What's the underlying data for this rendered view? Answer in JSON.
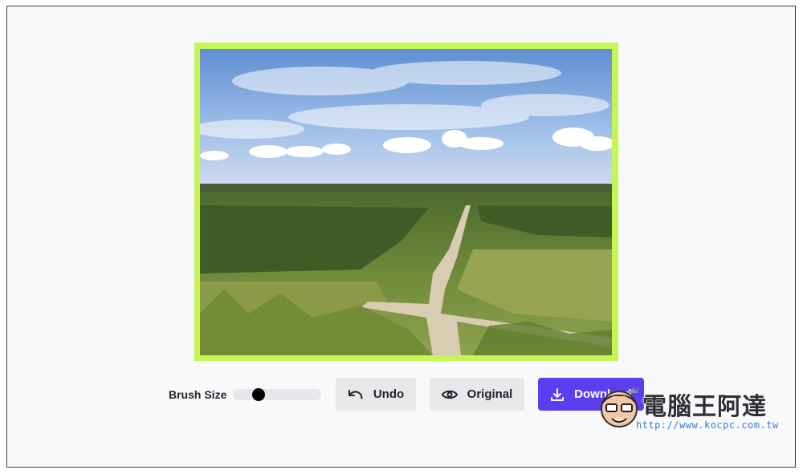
{
  "editor": {
    "brush_label": "Brush Size",
    "brush_level": 0.25,
    "undo_label": "Undo",
    "original_label": "Original",
    "download_label": "Download",
    "accent_color": "#5c3ef0",
    "border_color": "#c6f556"
  },
  "canvas": {
    "image_subject": "landscape-photo",
    "icon": "photo"
  },
  "watermark": {
    "title": "電腦王阿達",
    "url": "http://www.kocpc.com.tw"
  },
  "icons": {
    "undo": "undo-arrow-icon",
    "original": "eye-icon",
    "download": "download-icon"
  }
}
